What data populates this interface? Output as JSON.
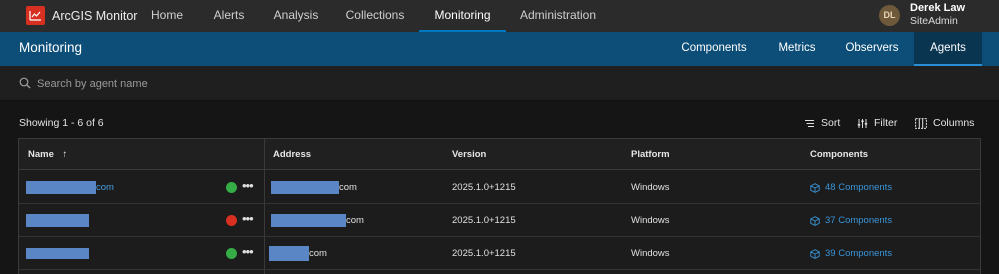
{
  "app": {
    "title": "ArcGIS Monitor"
  },
  "nav": {
    "items": [
      "Home",
      "Alerts",
      "Analysis",
      "Collections",
      "Monitoring",
      "Administration"
    ],
    "active": "Monitoring"
  },
  "user": {
    "initials": "DL",
    "name": "Derek Law",
    "role": "SiteAdmin"
  },
  "header": {
    "title": "Monitoring",
    "tabs": [
      "Components",
      "Metrics",
      "Observers",
      "Agents"
    ],
    "active_tab": "Agents"
  },
  "search": {
    "placeholder": "Search by agent name"
  },
  "toolbar": {
    "showing": "Showing 1 - 6 of 6",
    "sort": "Sort",
    "filter": "Filter",
    "columns": "Columns"
  },
  "table": {
    "columns": [
      "Name",
      "Address",
      "Version",
      "Platform",
      "Components"
    ],
    "sort_indicator": "↑",
    "rows": [
      {
        "name_suffix": "com",
        "status": "ok",
        "address_suffix": "com",
        "version": "2025.1.0+1215",
        "platform": "Windows",
        "components": "48 Components"
      },
      {
        "name_suffix": "",
        "status": "error",
        "address_suffix": "com",
        "version": "2025.1.0+1215",
        "platform": "Windows",
        "components": "37 Components"
      },
      {
        "name_suffix": "",
        "status": "ok",
        "address_suffix": "com",
        "version": "2025.1.0+1215",
        "platform": "Windows",
        "components": "39 Components"
      }
    ]
  },
  "colors": {
    "accent": "#0079c1",
    "header_bg": "#0d4e78",
    "link": "#3a95d9",
    "status_ok": "#35ac46",
    "status_error": "#d83020"
  },
  "icons": {
    "logo": "monitor-chart-icon",
    "search": "search-icon",
    "sort": "sort-icon",
    "filter": "filter-icon",
    "columns": "columns-icon",
    "component": "cube-icon",
    "more": "more-horizontal-icon"
  }
}
